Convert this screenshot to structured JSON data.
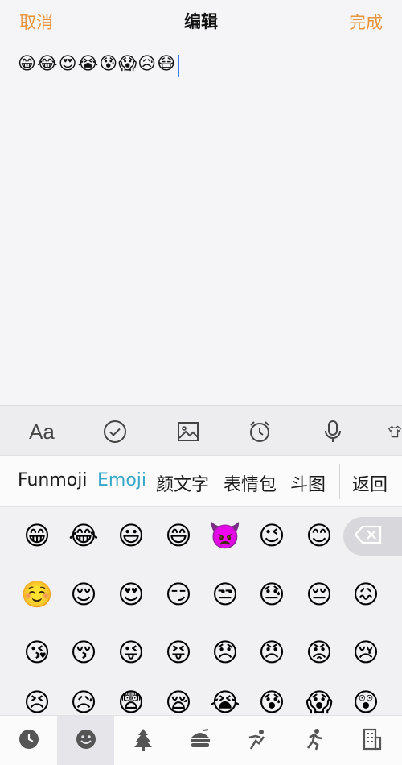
{
  "nav": {
    "cancel": "取消",
    "title": "编辑",
    "done": "完成",
    "accent_color": "#e8923a"
  },
  "editor": {
    "content": "😁😂😍😭😰😱😥😷"
  },
  "toolbar": {
    "font_label": "Aa",
    "icons": [
      "checkmark-circle-icon",
      "image-icon",
      "alarm-clock-icon",
      "microphone-icon",
      "shirt-icon"
    ]
  },
  "keyboard_tabs": {
    "items": [
      "Funmoji",
      "Emoji",
      "颜文字",
      "表情包",
      "斗图"
    ],
    "active": "Emoji",
    "back": "返回",
    "active_color": "#35a7c8"
  },
  "emoji_grid": {
    "rows": [
      [
        "😁",
        "😂",
        "😃",
        "😄",
        "👿",
        "😉",
        "😊"
      ],
      [
        "☺️",
        "😌",
        "😍",
        "😏",
        "😒",
        "😓",
        "😔",
        "😖"
      ],
      [
        "😘",
        "😚",
        "😜",
        "😝",
        "😞",
        "😠",
        "😡",
        "😢"
      ],
      [
        "😣",
        "😥",
        "😨",
        "😪",
        "😭",
        "😰",
        "😱",
        "😲"
      ]
    ]
  },
  "categories": {
    "items": [
      "clock-icon",
      "smiley-icon",
      "tree-icon",
      "burger-icon",
      "sports-icon",
      "running-icon",
      "building-icon"
    ],
    "active_index": 1
  }
}
